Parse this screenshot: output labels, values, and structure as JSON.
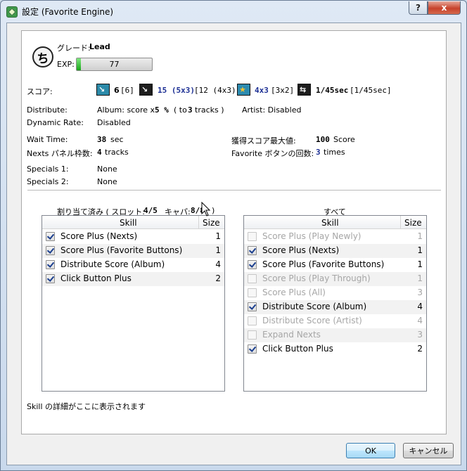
{
  "window": {
    "title": "設定 (Favorite Engine)",
    "help_label": "?",
    "close_label": "x"
  },
  "grade": {
    "label": "グレード:",
    "value": "Lead",
    "icon_glyph": "ち",
    "exp_label": "EXP:",
    "exp_value": "77",
    "exp_fraction": 0.06
  },
  "score": {
    "label": "スコア:",
    "items": [
      {
        "icon": "nexts-score-icon",
        "value": "6",
        "extra": "[6]"
      },
      {
        "icon": "favorite-button-score-icon",
        "value": "15 (5x3)",
        "extra": "[12 (4x3)]"
      },
      {
        "icon": "star-score-icon",
        "value": "4x3",
        "extra": "[3x2]"
      },
      {
        "icon": "time-score-icon",
        "value": "1/45sec",
        "extra": "[1/45sec]"
      }
    ]
  },
  "distribute": {
    "label": "Distribute:",
    "album_prefix": "Album: score x",
    "album_pct": "5 %",
    "album_mid": "( to",
    "album_tracks": "3",
    "album_suffix": "tracks )",
    "artist": "Artist: Disabled"
  },
  "dynamic_rate": {
    "label": "Dynamic Rate:",
    "value": "Disabled"
  },
  "wait_time": {
    "label": "Wait Time:",
    "value": "38",
    "unit": "sec"
  },
  "max_score": {
    "label": "獲得スコア最大値:",
    "value": "100",
    "unit": "Score"
  },
  "nexts_panel": {
    "label": "Nexts パネル枠数:",
    "value": "4",
    "unit": "tracks"
  },
  "favorite_count": {
    "label": "Favorite ボタンの回数:",
    "value": "3",
    "unit": "times"
  },
  "specials": [
    {
      "label": "Specials 1:",
      "value": "None"
    },
    {
      "label": "Specials 2:",
      "value": "None"
    }
  ],
  "assigned": {
    "caption_prefix": "割り当て済み ( スロット:",
    "slot": "4/5",
    "cap_label": "キャパ:",
    "cap": "8/8",
    "caption_suffix": ")",
    "col_skill": "Skill",
    "col_size": "Size",
    "rows": [
      {
        "name": "Score Plus (Nexts)",
        "size": "1",
        "checked": true
      },
      {
        "name": "Score Plus (Favorite Buttons)",
        "size": "1",
        "checked": true
      },
      {
        "name": "Distribute Score (Album)",
        "size": "4",
        "checked": true
      },
      {
        "name": "Click Button Plus",
        "size": "2",
        "checked": true
      }
    ]
  },
  "all": {
    "caption": "すべて",
    "col_skill": "Skill",
    "col_size": "Size",
    "rows": [
      {
        "name": "Score Plus (Play Newly)",
        "size": "1",
        "checked": false,
        "enabled": false
      },
      {
        "name": "Score Plus (Nexts)",
        "size": "1",
        "checked": true,
        "enabled": true
      },
      {
        "name": "Score Plus (Favorite Buttons)",
        "size": "1",
        "checked": true,
        "enabled": true
      },
      {
        "name": "Score Plus (Play Through)",
        "size": "1",
        "checked": false,
        "enabled": false
      },
      {
        "name": "Score Plus (All)",
        "size": "3",
        "checked": false,
        "enabled": false
      },
      {
        "name": "Distribute Score (Album)",
        "size": "4",
        "checked": true,
        "enabled": true
      },
      {
        "name": "Distribute Score (Artist)",
        "size": "4",
        "checked": false,
        "enabled": false
      },
      {
        "name": "Expand Nexts",
        "size": "3",
        "checked": false,
        "enabled": false
      },
      {
        "name": "Click Button Plus",
        "size": "2",
        "checked": true,
        "enabled": true
      }
    ]
  },
  "skill_detail": "Skill の詳細がここに表示されます",
  "buttons": {
    "ok": "OK",
    "cancel": "キャンセル"
  }
}
